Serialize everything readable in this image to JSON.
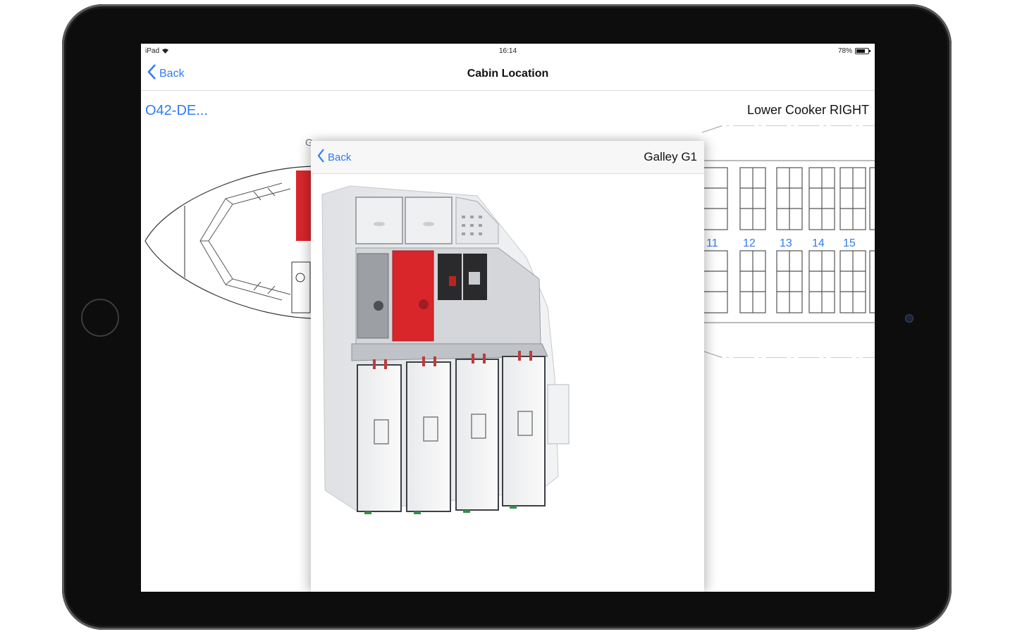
{
  "status_bar": {
    "device": "iPad",
    "time": "16:14",
    "battery": "78%",
    "battery_level": 0.78
  },
  "nav": {
    "back_label": "Back",
    "title": "Cabin Location"
  },
  "location": {
    "code": "O42-DE...",
    "part_name": "Lower Cooker RIGHT"
  },
  "seat_rows": [
    "11",
    "12",
    "13",
    "14",
    "15"
  ],
  "modal": {
    "back_label": "Back",
    "title": "Galley G1",
    "covered_label": "G"
  },
  "colors": {
    "accent": "#2f7bf5",
    "highlight": "#d9262b"
  }
}
